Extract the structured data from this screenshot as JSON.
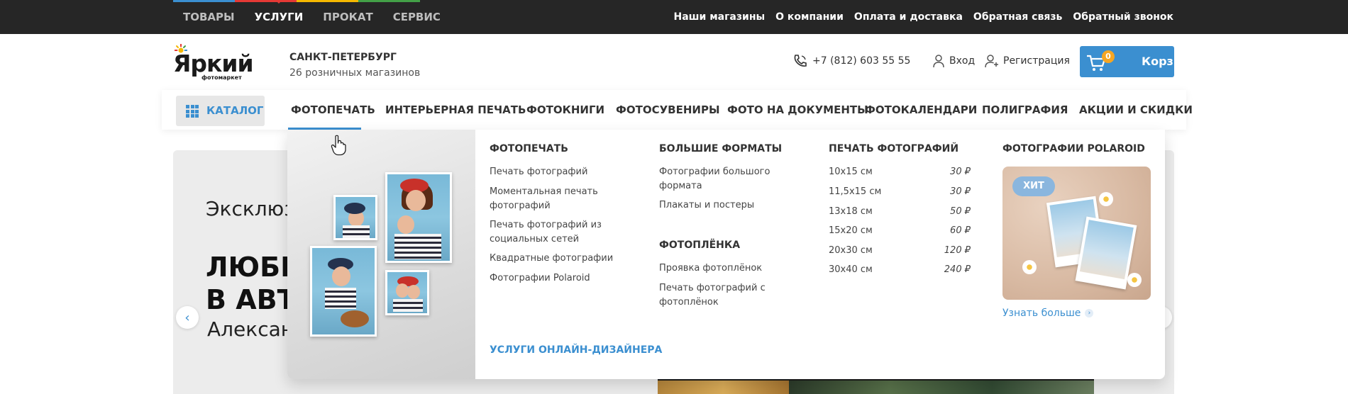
{
  "topbar": {
    "nav": [
      "ТОВАРЫ",
      "УСЛУГИ",
      "ПРОКАТ",
      "СЕРВИС"
    ],
    "active_index": 1,
    "stripe_colors": [
      "#3b8fd0",
      "#e53935",
      "#f5b800",
      "#43a047"
    ],
    "links": [
      "Наши магазины",
      "О компании",
      "Оплата и доставка",
      "Обратная связь",
      "Обратный звонок"
    ]
  },
  "header": {
    "logo_word": "Яркий",
    "logo_sub": "фотомаркет",
    "city": "САНКТ-ПЕТЕРБУРГ",
    "stores": "26 розничных магазинов",
    "phone": "+7 (812) 603 55 55",
    "login": "Вход",
    "register": "Регистрация",
    "cart_label": "Корзина",
    "cart_count": "0",
    "accent_color": "#3b8fd0"
  },
  "catnav": {
    "catalog": "КАТАЛОГ",
    "items": [
      "ФОТОПЕЧАТЬ",
      "ИНТЕРЬЕРНАЯ ПЕЧАТЬ",
      "ФОТОКНИГИ",
      "ФОТОСУВЕНИРЫ",
      "ФОТО НА ДОКУМЕНТЫ",
      "ФОТОКАЛЕНДАРИ",
      "ПОЛИГРАФИЯ",
      "АКЦИИ И СКИДКИ"
    ]
  },
  "hero": {
    "line1": "Эксклюзи",
    "line2a": "ЛЮБИ",
    "line2b": "В АВТО",
    "line3": "Александ"
  },
  "menu": {
    "col1": {
      "title": "ФОТОПЕЧАТЬ",
      "links": [
        "Печать фотографий",
        "Моментальная печать фотографий",
        "Печать фотографий из социальных сетей",
        "Квадратные фотографии",
        "Фотографии Polaroid"
      ]
    },
    "col2": {
      "title": "БОЛЬШИЕ ФОРМАТЫ",
      "links": [
        "Фотографии большого формата",
        "Плакаты и постеры"
      ],
      "title2": "ФОТОПЛЁНКА",
      "links2": [
        "Проявка фотоплёнок",
        "Печать фотографий с фотоплёнок"
      ]
    },
    "col3": {
      "title": "ПЕЧАТЬ ФОТОГРАФИЙ",
      "prices": [
        {
          "size": "10х15 см",
          "price": "30 ₽"
        },
        {
          "size": "11,5х15 см",
          "price": "30 ₽"
        },
        {
          "size": "13х18 см",
          "price": "50 ₽"
        },
        {
          "size": "15х20 см",
          "price": "60 ₽"
        },
        {
          "size": "20х30 см",
          "price": "120 ₽"
        },
        {
          "size": "30х40 см",
          "price": "240 ₽"
        }
      ]
    },
    "col4": {
      "title": "ФОТОГРАФИИ POLAROID",
      "badge": "ХИТ",
      "more": "Узнать больше"
    },
    "designer": "УСЛУГИ ОНЛАЙН-ДИЗАЙНЕРА"
  }
}
